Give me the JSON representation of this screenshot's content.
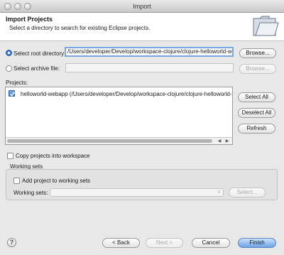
{
  "window": {
    "title": "Import"
  },
  "banner": {
    "title": "Import Projects",
    "description": "Select a directory to search for existing Eclipse projects."
  },
  "source": {
    "root_label": "Select root directory:",
    "root_value": "/Users/developer/Develop/workspace-clojure/clojure-helloworld-webapp",
    "root_selected": true,
    "archive_label": "Select archive file:",
    "archive_value": "",
    "browse_label": "Browse...",
    "browse_archive_label": "Browse..."
  },
  "projects": {
    "label": "Projects:",
    "items": [
      {
        "label": "helloworld-webapp (/Users/developer/Develop/workspace-clojure/clojure-helloworld-webapp)",
        "checked": true
      }
    ],
    "select_all_label": "Select All",
    "deselect_all_label": "Deselect All",
    "refresh_label": "Refresh",
    "scroll_left": "◀",
    "scroll_right": "▶"
  },
  "copy_projects": {
    "label": "Copy projects into workspace",
    "checked": false
  },
  "working_sets": {
    "group_label": "Working sets",
    "add_label": "Add project to working sets",
    "add_checked": false,
    "sets_label": "Working sets:",
    "select_value": "",
    "select_label": "Select..."
  },
  "footer": {
    "help": "?",
    "back_label": "< Back",
    "next_label": "Next >",
    "cancel_label": "Cancel",
    "finish_label": "Finish"
  },
  "colors": {
    "accent": "#3b78d4",
    "banner_bg": "#ffffff",
    "dialog_bg": "#e8e8e8"
  }
}
